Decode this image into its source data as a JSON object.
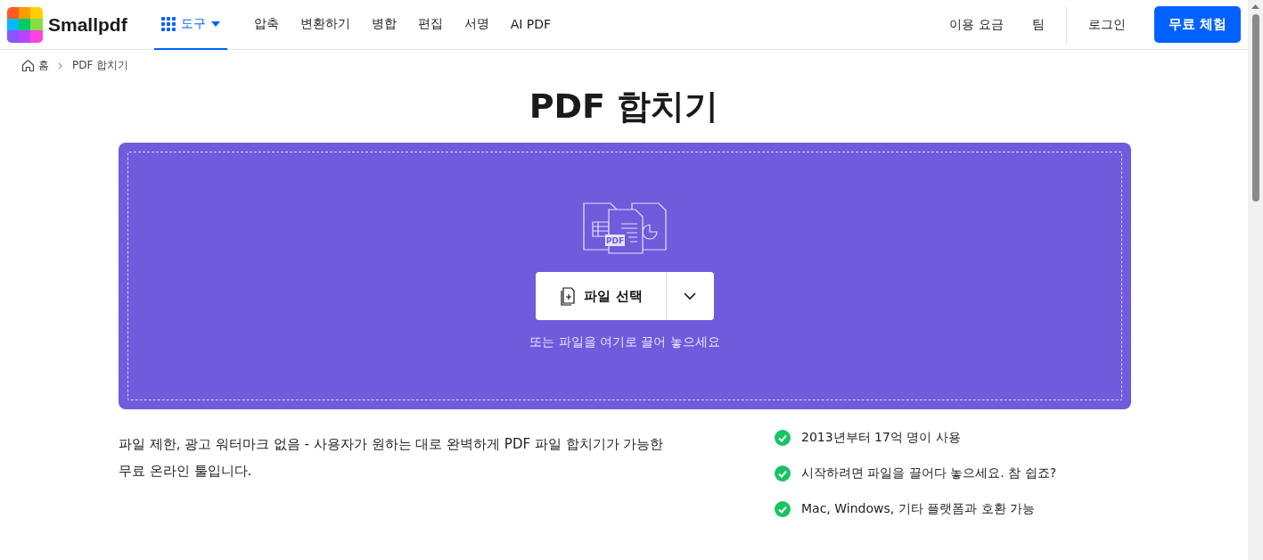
{
  "header": {
    "logo": "Smallpdf",
    "nav": [
      {
        "label": "도구",
        "selected": true,
        "kind": "menu"
      },
      {
        "label": "압축",
        "selected": false,
        "kind": "link"
      },
      {
        "label": "변환하기",
        "selected": false,
        "kind": "link"
      },
      {
        "label": "병합",
        "selected": false,
        "kind": "link"
      },
      {
        "label": "편집",
        "selected": false,
        "kind": "link"
      },
      {
        "label": "서명",
        "selected": false,
        "kind": "link"
      },
      {
        "label": "AI PDF",
        "selected": false,
        "kind": "link"
      }
    ],
    "right_links": [
      "이용 요금",
      "팀"
    ],
    "login": "로그인",
    "cta": "무료 체험"
  },
  "breadcrumb": [
    "홈",
    "PDF 합치기"
  ],
  "title": "PDF 합치기",
  "upload": {
    "pdf_badge": "PDF",
    "button": "파일 선택",
    "hint": "또는 파일을 여기로 끌어 놓으세요"
  },
  "description": "파일 제한, 광고 워터마크 없음 - 사용자가 원하는 대로 완벽하게 PDF 파일 합치기가 가능한 무료 온라인 툴입니다.",
  "features": [
    "2013년부터 17억 명이 사용",
    "시작하려면 파일을 끌어다 놓으세요. 참 쉽죠?",
    "Mac, Windows, 기타 플랫폼과 호환 가능"
  ]
}
